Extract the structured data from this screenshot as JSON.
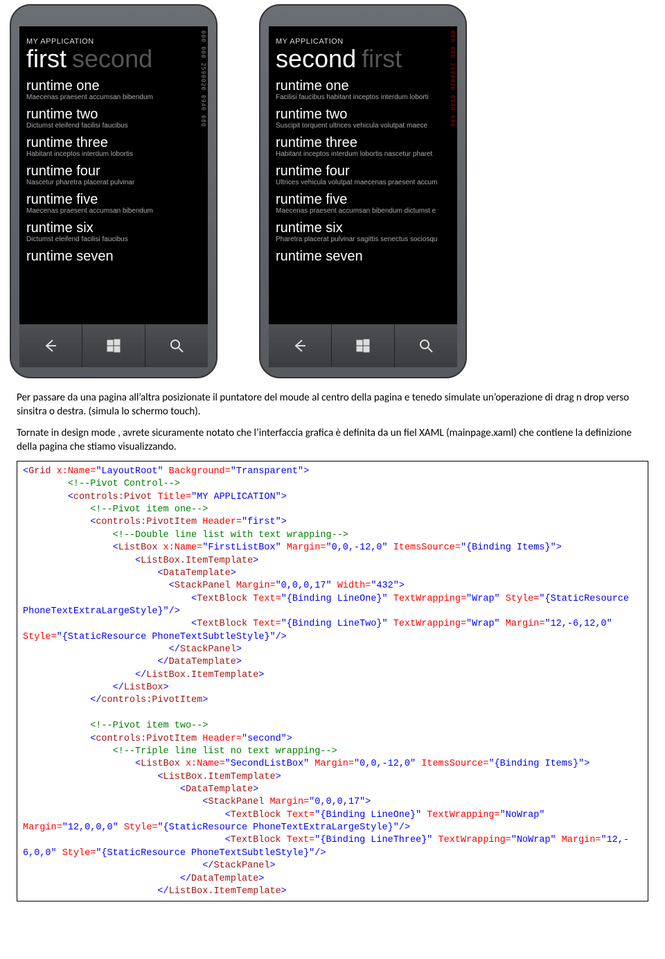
{
  "app_title": "MY APPLICATION",
  "phone_left": {
    "pivot_active": "first",
    "pivot_inactive": "second",
    "side_text": "000 000 2590020 0940 080",
    "items": [
      {
        "title": "runtime one",
        "sub": "Maecenas praesent accumsan bibendum"
      },
      {
        "title": "runtime two",
        "sub": "Dictumst eleifend facilisi faucibus"
      },
      {
        "title": "runtime three",
        "sub": "Habitant inceptos interdum lobortis"
      },
      {
        "title": "runtime four",
        "sub": "Nascetur pharetra placerat pulvinar"
      },
      {
        "title": "runtime five",
        "sub": "Maecenas praesent accumsan bibendum"
      },
      {
        "title": "runtime six",
        "sub": "Dictumst eleifend facilisi faucibus"
      },
      {
        "title": "runtime seven",
        "sub": ""
      }
    ]
  },
  "phone_right": {
    "pivot_active": "second",
    "pivot_inactive": "first",
    "side_text": "000 000 2590020 0940 080",
    "items": [
      {
        "title": "runtime one",
        "sub": "Facilisi faucibus habitant inceptos interdum loborti"
      },
      {
        "title": "runtime two",
        "sub": "Suscipit torquent ultrices vehicula volutpat maece"
      },
      {
        "title": "runtime three",
        "sub": "Habitant inceptos interdum lobortis nascetur pharet"
      },
      {
        "title": "runtime four",
        "sub": "Ultrices vehicula volutpat maecenas praesent accum"
      },
      {
        "title": "runtime five",
        "sub": "Maecenas praesent accumsan bibendum dictumst e"
      },
      {
        "title": "runtime six",
        "sub": "Pharetra placerat pulvinar sagittis senectus sociosqu"
      },
      {
        "title": "runtime seven",
        "sub": ""
      }
    ]
  },
  "prose": {
    "p1": "Per passare da una pagina all’altra posizionate  il puntatore del moude al centro della pagina e tenedo simulate un’operazione di drag n drop verso sinsitra o destra. (simula lo schermo touch).",
    "p2": "Tornate in design mode , avrete sicuramente notato che l’interfaccia grafica è definita da un fiel XAML (mainpage.xaml) che contiene la definizione della pagina che stiamo visualizzando."
  },
  "code": {
    "l01a": "<Grid",
    "l01_attr1n": " x:Name=",
    "l01_attr1v": "\"LayoutRoot\"",
    "l01_attr2n": " Background=",
    "l01_attr2v": "\"Transparent\"",
    "l01b": ">",
    "l02": "        <!--Pivot Control-->",
    "l03a": "        <controls:Pivot",
    "l03_attr1n": " Title=",
    "l03_attr1v": "\"MY APPLICATION\"",
    "l03b": ">",
    "l04": "            <!--Pivot item one-->",
    "l05a": "            <controls:PivotItem",
    "l05_attr1n": " Header=",
    "l05_attr1v": "\"first\"",
    "l05b": ">",
    "l06": "                <!--Double line list with text wrapping-->",
    "l07a": "                <ListBox",
    "l07_a1n": " x:Name=",
    "l07_a1v": "\"FirstListBox\"",
    "l07_a2n": " Margin=",
    "l07_a2v": "\"0,0,-12,0\"",
    "l07_a3n": " ItemsSource=",
    "l07_a3v": "\"{Binding Items}\"",
    "l07b": ">",
    "l08": "                    <ListBox.ItemTemplate>",
    "l09": "                        <DataTemplate>",
    "l10a": "                          <StackPanel",
    "l10_a1n": " Margin=",
    "l10_a1v": "\"0,0,0,17\"",
    "l10_a2n": " Width=",
    "l10_a2v": "\"432\"",
    "l10b": ">",
    "l11a": "                              <TextBlock",
    "l11_a1n": " Text=",
    "l11_a1v": "\"{Binding LineOne}\"",
    "l11_a2n": " TextWrapping=",
    "l11_a2v": "\"Wrap\"",
    "l11_a3n": " Style=",
    "l11_a3v": "\"{StaticResource",
    "l12": "PhoneTextExtraLargeStyle}\"/>",
    "l13a": "                              <TextBlock",
    "l13_a1n": " Text=",
    "l13_a1v": "\"{Binding LineTwo}\"",
    "l13_a2n": " TextWrapping=",
    "l13_a2v": "\"Wrap\"",
    "l13_a3n": " Margin=",
    "l13_a3v": "\"12,-6,12,0\"",
    "l14": "Style=\"{StaticResource PhoneTextSubtleStyle}\"/>",
    "l15": "                          </StackPanel>",
    "l16": "                        </DataTemplate>",
    "l17": "                    </ListBox.ItemTemplate>",
    "l18": "                </ListBox>",
    "l19": "            </controls:PivotItem>",
    "blank": "",
    "l20": "            <!--Pivot item two-->",
    "l21a": "            <controls:PivotItem",
    "l21_a1n": " Header=",
    "l21_a1v": "\"second\"",
    "l21b": ">",
    "l22": "                <!--Triple line list no text wrapping-->",
    "l23a": "                    <ListBox",
    "l23_a1n": " x:Name=",
    "l23_a1v": "\"SecondListBox\"",
    "l23_a2n": " Margin=",
    "l23_a2v": "\"0,0,-12,0\"",
    "l23_a3n": " ItemsSource=",
    "l23_a3v": "\"{Binding Items}\"",
    "l23b": ">",
    "l24": "                        <ListBox.ItemTemplate>",
    "l25": "                            <DataTemplate>",
    "l26a": "                                <StackPanel",
    "l26_a1n": " Margin=",
    "l26_a1v": "\"0,0,0,17\"",
    "l26b": ">",
    "l27a": "                                    <TextBlock",
    "l27_a1n": " Text=",
    "l27_a1v": "\"{Binding LineOne}\"",
    "l27_a2n": " TextWrapping=",
    "l27_a2v": "\"NoWrap\"",
    "l28": "Margin=\"12,0,0,0\" Style=\"{StaticResource PhoneTextExtraLargeStyle}\"/>",
    "l29a": "                                    <TextBlock",
    "l29_a1n": " Text=",
    "l29_a1v": "\"{Binding LineThree}\"",
    "l29_a2n": " TextWrapping=",
    "l29_a2v": "\"NoWrap\"",
    "l29_a3n": " Margin=",
    "l29_a3v": "\"12,-",
    "l30": "6,0,0\" Style=\"{StaticResource PhoneTextSubtleStyle}\"/>",
    "l31": "                                </StackPanel>",
    "l32": "                            </DataTemplate>",
    "l33": "                        </ListBox.ItemTemplate>"
  }
}
